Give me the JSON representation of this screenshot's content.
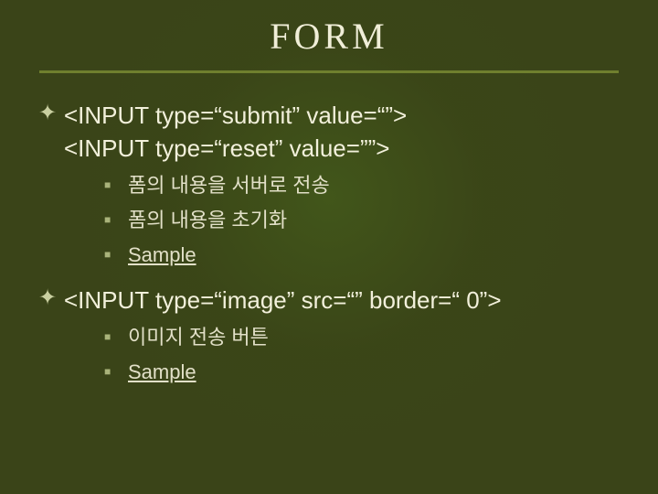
{
  "title": "FORM",
  "block1": {
    "line1": "<INPUT type=“submit” value=“”>",
    "line2": "<INPUT type=“reset” value=””>",
    "sub1": "폼의 내용을 서버로 전송",
    "sub2": "폼의 내용을 초기화",
    "sub3": "Sample"
  },
  "block2": {
    "line1": "<INPUT type=“image” src=“” border=“ 0”>",
    "sub1": "이미지 전송 버튼",
    "sub2": "Sample"
  }
}
